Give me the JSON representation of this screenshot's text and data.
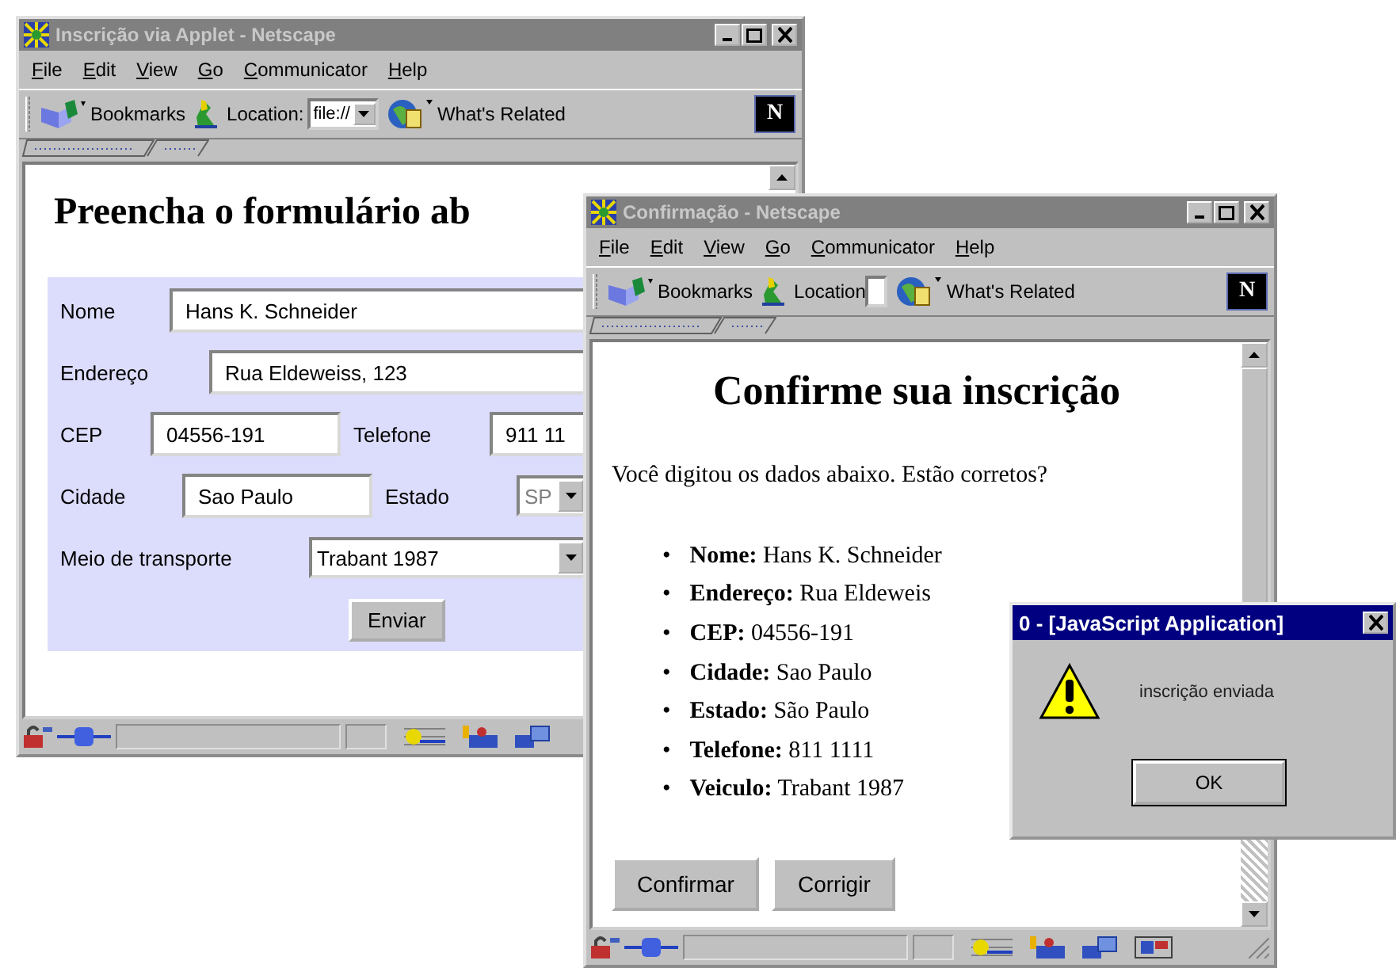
{
  "windows": [
    {
      "kind": "browser",
      "title": "Inscrição via Applet - Netscape",
      "active": false,
      "menu": [
        "File",
        "Edit",
        "View",
        "Go",
        "Communicator",
        "Help"
      ],
      "toolbar": {
        "bookmarks": "Bookmarks",
        "location_label": "Location:",
        "location_value": "file://",
        "related": "What's Related",
        "logo": "N"
      },
      "page": {
        "kind": "form",
        "heading": "Preencha o formulário ab",
        "rows": [
          {
            "fields": [
              {
                "kind": "label",
                "text": "Nome"
              },
              {
                "kind": "text",
                "value": "Hans K. Schneider"
              }
            ]
          },
          {
            "fields": [
              {
                "kind": "label",
                "text": "Endereço"
              },
              {
                "kind": "text",
                "value": "Rua Eldeweiss, 123"
              }
            ]
          },
          {
            "fields": [
              {
                "kind": "label",
                "text": "CEP"
              },
              {
                "kind": "text",
                "value": "04556-191"
              },
              {
                "kind": "label",
                "text": "Telefone"
              },
              {
                "kind": "text",
                "value": "911 11"
              }
            ]
          },
          {
            "fields": [
              {
                "kind": "label",
                "text": "Cidade"
              },
              {
                "kind": "text",
                "value": "Sao Paulo"
              },
              {
                "kind": "label",
                "text": "Estado"
              },
              {
                "kind": "select",
                "value": "SP",
                "disabled": true
              }
            ]
          },
          {
            "fields": [
              {
                "kind": "label",
                "text": "Meio de transporte"
              },
              {
                "kind": "select",
                "value": "Trabant 1987",
                "disabled": false
              }
            ]
          }
        ],
        "submit": "Enviar"
      }
    },
    {
      "kind": "browser",
      "title": "Confirmação - Netscape",
      "active": false,
      "menu": [
        "File",
        "Edit",
        "View",
        "Go",
        "Communicator",
        "Help"
      ],
      "toolbar": {
        "bookmarks": "Bookmarks",
        "location_label": "Location",
        "related": "What's Related",
        "logo": "N"
      },
      "page": {
        "kind": "confirmation",
        "heading": "Confirme sua inscrição",
        "intro": "Você digitou os dados abaixo. Estão corretos?",
        "items": [
          {
            "marker": "•",
            "text": "**Nome:** Hans K. Schneider"
          },
          {
            "marker": "•",
            "text": "**Endereço:** Rua Eldeweis"
          },
          {
            "marker": "•",
            "text": "**CEP:** 04556-191"
          },
          {
            "marker": "•",
            "text": "**Cidade:** Sao Paulo"
          },
          {
            "marker": "•",
            "text": "**Estado:** São Paulo"
          },
          {
            "marker": "•",
            "text": "**Telefone:** 811 1111"
          },
          {
            "marker": "•",
            "text": "**Veiculo:** Trabant 1987"
          }
        ],
        "buttons": [
          "Confirmar",
          "Corrigir"
        ]
      }
    }
  ],
  "dialog": {
    "title": "0 - [JavaScript Application]",
    "active": true,
    "message": "inscrição enviada",
    "button": "OK"
  }
}
